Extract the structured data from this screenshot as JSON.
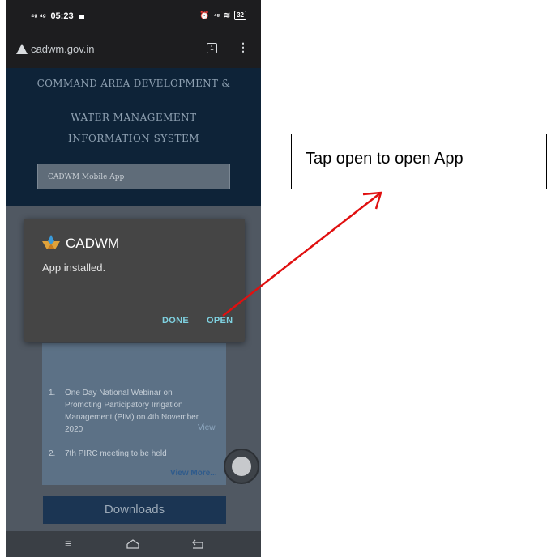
{
  "status_bar": {
    "signal": "⁴ᵍ ⁴ᵍ",
    "time": "05:23",
    "right_icons": "⏰ ⁴ᵍ ≋",
    "battery": "32"
  },
  "browser": {
    "url": "cadwm.gov.in",
    "tab_count": "1",
    "menu_icon": "⋮"
  },
  "site": {
    "title_line1": "COMMAND AREA DEVELOPMENT &",
    "title_line2": "WATER MANAGEMENT",
    "title_line3": "INFORMATION SYSTEM",
    "app_link": "CADWM Mobile App"
  },
  "news": {
    "items": [
      {
        "num": "1.",
        "text": "One Day National Webinar on Promoting Participatory Irrigation Management (PIM) on 4th November 2020",
        "link": "View"
      },
      {
        "num": "2.",
        "text": "7th PIRC meeting to be held"
      }
    ],
    "view_more": "View More..."
  },
  "downloads_label": "Downloads",
  "dialog": {
    "app_name": "CADWM",
    "message": "App installed.",
    "done_label": "DONE",
    "open_label": "OPEN"
  },
  "annotation": {
    "text": "Tap open to open App",
    "arrow_color": "#e01010"
  },
  "colors": {
    "dialog_button": "#7fd1e0",
    "header_bg": "#0e2338"
  }
}
